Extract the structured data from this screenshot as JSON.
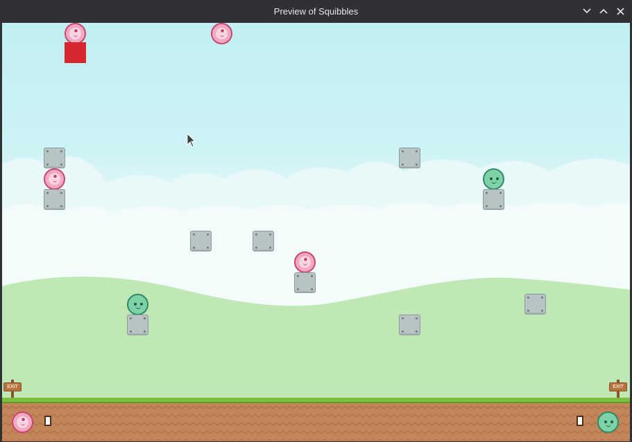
{
  "window": {
    "title": "Preview of Squibbles",
    "controls": [
      "minimize",
      "maximize",
      "close"
    ]
  },
  "game": {
    "exit_signs": {
      "left": "EXIT",
      "right": "EXIT"
    },
    "hud": {
      "left_player_icon": "pink-squibble-icon",
      "right_player_icon": "green-squibble-icon"
    }
  },
  "colors": {
    "titlebar": "#2f3136",
    "sky": "#c1eff2",
    "hills": "#bfe8b5",
    "ground": "#c2865a",
    "grass": "#7cbf3f",
    "pink_squibble": "#f3a8c2",
    "green_squibble": "#7dd3a6",
    "block": "#b8c3c5",
    "red_square": "#d7262e"
  }
}
